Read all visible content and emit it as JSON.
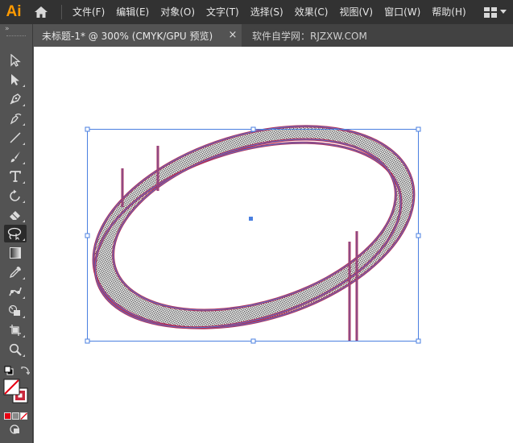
{
  "app": {
    "logo": "Ai"
  },
  "menubar": {
    "items": [
      "文件(F)",
      "编辑(E)",
      "对象(O)",
      "文字(T)",
      "选择(S)",
      "效果(C)",
      "视图(V)",
      "窗口(W)",
      "帮助(H)"
    ]
  },
  "toolbar": {
    "collapse_label": "»",
    "tools": [
      "selection-tool",
      "direct-selection-tool",
      "pen-tool",
      "curvature-tool",
      "line-segment-tool",
      "paintbrush-tool",
      "type-tool",
      "rotate-tool",
      "eraser-tool",
      "lasso-tool",
      "gradient-tool",
      "eyedropper-tool",
      "puppet-warp-tool",
      "shape-builder-tool",
      "artboard-tool",
      "zoom-tool"
    ],
    "active_tool": "lasso-tool"
  },
  "tabs": [
    {
      "label": "未标题-1* @ 300% (CMYK/GPU 预览)",
      "close": "×"
    }
  ],
  "watermark": "软件自学网：RJZXW.COM",
  "colors": {
    "stroke": "#b0305a",
    "selection": "#4a7fe0",
    "ai_orange": "#ff9a00"
  }
}
